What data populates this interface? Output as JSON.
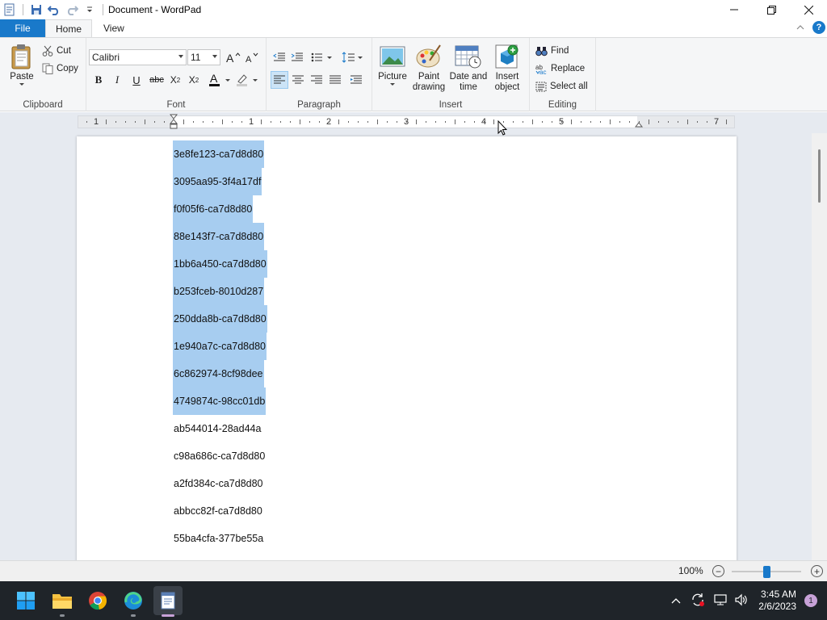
{
  "window": {
    "title": "Document - WordPad"
  },
  "tabs": {
    "file": "File",
    "home": "Home",
    "view": "View"
  },
  "ribbon": {
    "clipboard": {
      "paste": "Paste",
      "cut": "Cut",
      "copy": "Copy",
      "label": "Clipboard"
    },
    "font": {
      "family": "Calibri",
      "size": "11",
      "label": "Font"
    },
    "paragraph": {
      "label": "Paragraph"
    },
    "insert": {
      "picture": "Picture",
      "paint_line1": "Paint",
      "paint_line2": "drawing",
      "date_line1": "Date and",
      "date_line2": "time",
      "object_line1": "Insert",
      "object_line2": "object",
      "label": "Insert"
    },
    "editing": {
      "find": "Find",
      "replace": "Replace",
      "select_all": "Select all",
      "label": "Editing"
    }
  },
  "ruler": {
    "numbers": [
      "1",
      "1",
      "2",
      "3",
      "4",
      "5",
      "7"
    ]
  },
  "document": {
    "lines": [
      {
        "text": "3e8fe123-ca7d8d80",
        "selected": true
      },
      {
        "text": "3095aa95-3f4a17df",
        "selected": true
      },
      {
        "text": "f0f05f6-ca7d8d80",
        "selected": true
      },
      {
        "text": "88e143f7-ca7d8d80",
        "selected": true
      },
      {
        "text": "1bb6a450-ca7d8d80",
        "selected": true
      },
      {
        "text": "b253fceb-8010d287",
        "selected": true
      },
      {
        "text": "250dda8b-ca7d8d80",
        "selected": true
      },
      {
        "text": "1e940a7c-ca7d8d80",
        "selected": true
      },
      {
        "text": "6c862974-8cf98dee",
        "selected": true
      },
      {
        "text": "4749874c-98cc01db",
        "selected": true
      },
      {
        "text": "ab544014-28ad44a",
        "selected": false
      },
      {
        "text": "c98a686c-ca7d8d80",
        "selected": false
      },
      {
        "text": "a2fd384c-ca7d8d80",
        "selected": false
      },
      {
        "text": "abbcc82f-ca7d8d80",
        "selected": false
      },
      {
        "text": "55ba4cfa-377be55a",
        "selected": false
      }
    ]
  },
  "status": {
    "zoom": "100%",
    "zoom_level": 0.5
  },
  "taskbar": {
    "time": "3:45 AM",
    "date": "2/6/2023",
    "notifications": "1"
  },
  "colors": {
    "accent": "#1979ca",
    "selection": "#a7cdf0",
    "taskbar": "#1f2429"
  }
}
